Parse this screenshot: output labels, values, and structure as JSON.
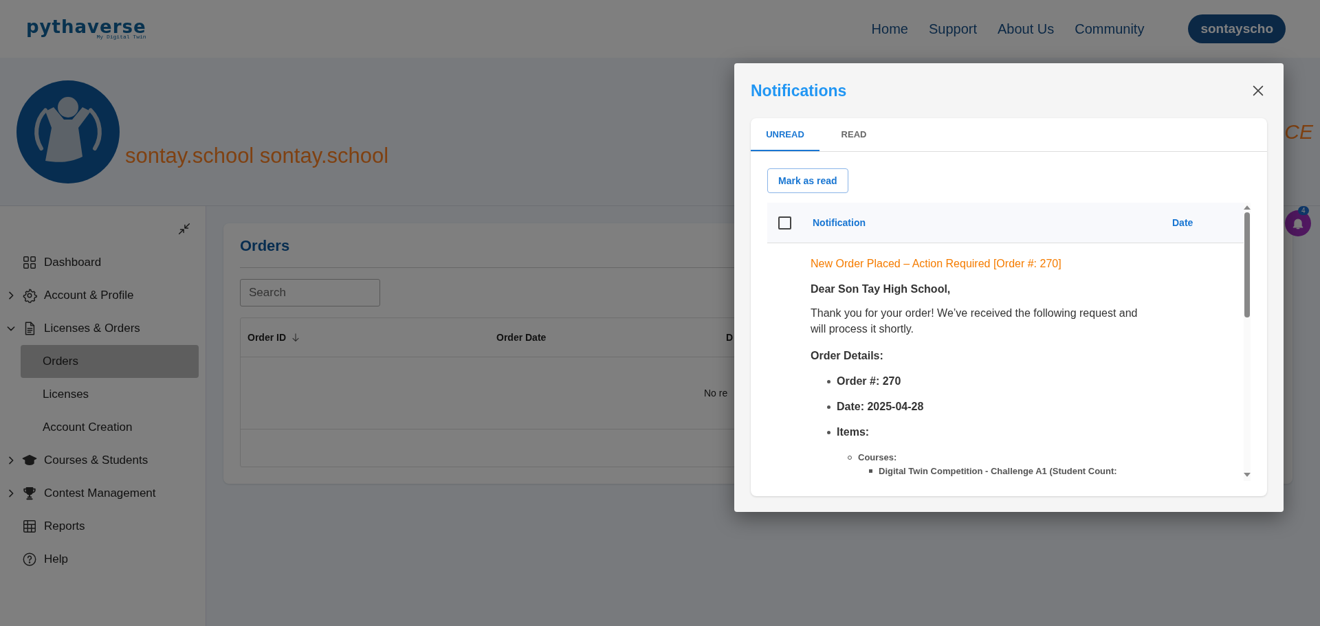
{
  "header": {
    "logo": {
      "name": "pythaverse",
      "tagline": "My Digital Twin"
    },
    "nav": [
      {
        "label": "Home"
      },
      {
        "label": "Support"
      },
      {
        "label": "About Us"
      },
      {
        "label": "Community"
      }
    ],
    "user_button": "sontayscho"
  },
  "profile": {
    "name": "sontay.school sontay.school",
    "side_text": "CE"
  },
  "sidebar": {
    "items": [
      {
        "label": "Dashboard",
        "selected": false
      },
      {
        "label": "Account & Profile",
        "expanded": false,
        "selected": false
      },
      {
        "label": "Licenses & Orders",
        "expanded": true,
        "selected": false,
        "children": [
          {
            "label": "Orders",
            "selected": true
          },
          {
            "label": "Licenses",
            "selected": false
          },
          {
            "label": "Account Creation",
            "selected": false
          }
        ]
      },
      {
        "label": "Courses & Students",
        "expanded": false,
        "selected": false
      },
      {
        "label": "Contest Management",
        "expanded": false,
        "selected": false
      },
      {
        "label": "Reports",
        "selected": false
      },
      {
        "label": "Help",
        "selected": false
      }
    ]
  },
  "orders": {
    "title": "Orders",
    "search": {
      "placeholder": "Search"
    },
    "columns": [
      {
        "label": "Order ID",
        "sorted": true
      },
      {
        "label": "Order Date",
        "sorted": false
      },
      {
        "label": "D",
        "sorted": false
      }
    ],
    "empty_text": "No re"
  },
  "notifications_button": {
    "badge": "4"
  },
  "dialog": {
    "title": "Notifications",
    "tabs": [
      {
        "label": "UNREAD",
        "selected": true
      },
      {
        "label": "READ",
        "selected": false
      }
    ],
    "mark_button": "Mark as read",
    "table": {
      "select_all": {
        "checked": false
      },
      "columns": [
        "Notification",
        "Date"
      ],
      "rows": [
        {
          "title": "New Order Placed – Action Required [Order #: 270]",
          "greeting": "Dear Son Tay High School,",
          "message": "Thank you for your order! We’ve received the following request and will process it shortly.",
          "details_heading": "Order Details:",
          "details": [
            {
              "text": "Order #: 270"
            },
            {
              "text": "Date: 2025-04-28"
            },
            {
              "text": "Items:",
              "children": [
                {
                  "text": "Courses:",
                  "children": [
                    {
                      "text": "Digital Twin Competition - Challenge A1 (Student Count:"
                    }
                  ]
                }
              ]
            }
          ]
        }
      ]
    }
  }
}
